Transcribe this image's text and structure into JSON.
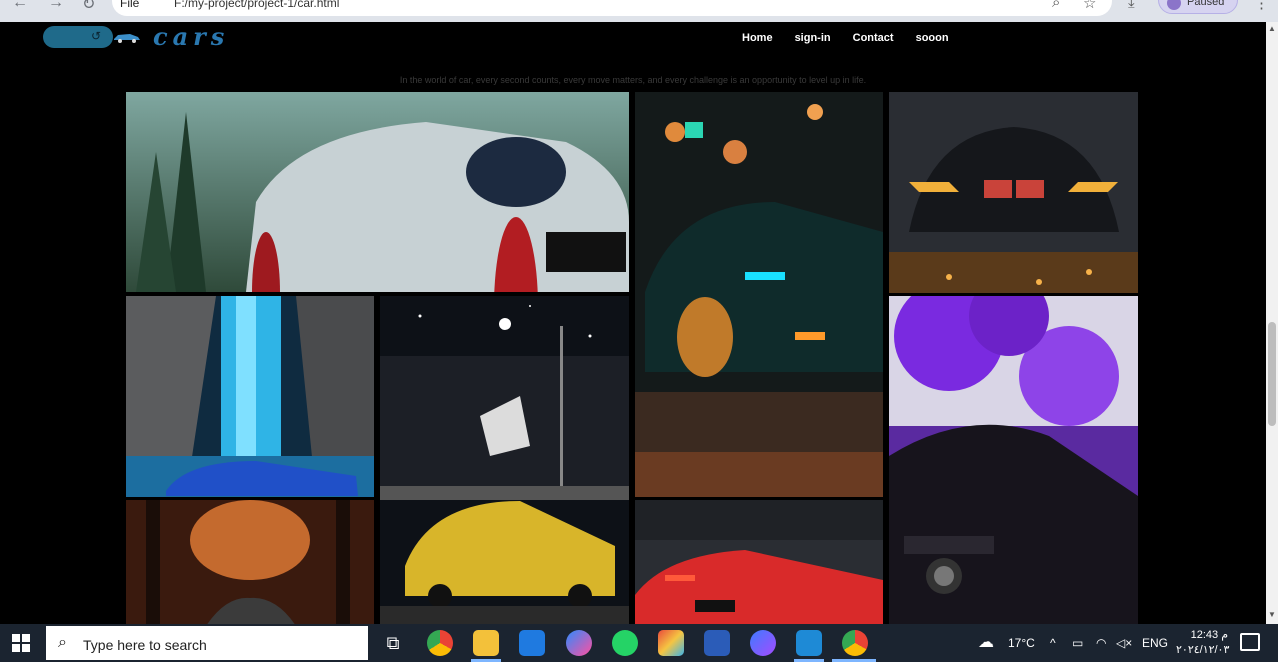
{
  "browser": {
    "file_chip": "File",
    "url": "F:/my-project/project-1/car.html",
    "profile_label": "Paused"
  },
  "site": {
    "logo_text": "cars",
    "nav": [
      "Home",
      "sign-in",
      "Contact",
      "sooon"
    ],
    "tagline": "In the world of car, every second counts, every move matters, and every challenge is an opportunity to level up in life."
  },
  "gallery": {
    "images": [
      "white-porsche-911-gt3-forest-road",
      "dark-muscle-car-neon-street",
      "bmw-m4-glowing-headlights-rain",
      "blue-supercar-by-waterfall",
      "yellow-mazda-rx7-night-overpass",
      "mercedes-amg-gt-purple-trees",
      "car-in-autumn-forest",
      "red-audi-r8-garage"
    ]
  },
  "taskbar": {
    "search_placeholder": "Type here to search",
    "weather": "17°C",
    "language": "ENG",
    "time": "12:43 م",
    "date": "٢٠٢٤/١٢/٠٣",
    "apps": [
      "task-view",
      "chrome",
      "file-explorer",
      "microsoft-store",
      "messenger",
      "whatsapp",
      "paint",
      "word",
      "copilot",
      "vscode",
      "chrome-profile"
    ]
  },
  "colors": {
    "page_bg": "#000000",
    "logo_blue": "#2a78b0",
    "taskbar_bg": "#1b2430"
  }
}
